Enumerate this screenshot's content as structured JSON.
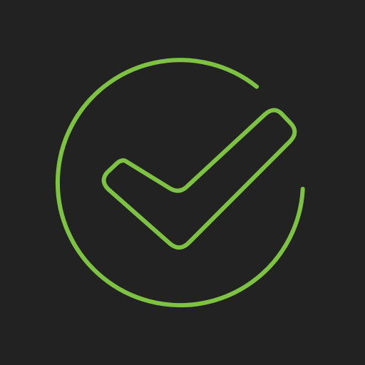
{
  "icon": {
    "name": "check-circle-icon",
    "colors": {
      "background": "#222222",
      "stroke": "#7DC242"
    }
  }
}
